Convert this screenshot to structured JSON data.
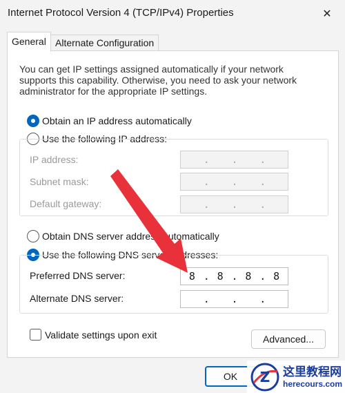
{
  "window": {
    "title": "Internet Protocol Version 4 (TCP/IPv4) Properties",
    "close_glyph": "✕"
  },
  "tabs": [
    {
      "label": "General",
      "active": true
    },
    {
      "label": "Alternate Configuration",
      "active": false
    }
  ],
  "info_text": "You can get IP settings assigned automatically if your network supports this capability. Otherwise, you need to ask your network administrator for the appropriate IP settings.",
  "ip_section": {
    "obtain_auto_label": "Obtain an IP address automatically",
    "obtain_auto_checked": true,
    "use_following_label": "Use the following IP address:",
    "use_following_checked": false,
    "fields": [
      {
        "label": "IP address:",
        "segments": [
          "",
          "",
          "",
          ""
        ]
      },
      {
        "label": "Subnet mask:",
        "segments": [
          "",
          "",
          "",
          ""
        ]
      },
      {
        "label": "Default gateway:",
        "segments": [
          "",
          "",
          "",
          ""
        ]
      }
    ]
  },
  "dns_section": {
    "obtain_auto_label": "Obtain DNS server address automatically",
    "obtain_auto_checked": false,
    "use_following_label": "Use the following DNS server addresses:",
    "use_following_checked": true,
    "preferred": {
      "label": "Preferred DNS server:",
      "segments": [
        "8",
        "8",
        "8",
        "8"
      ]
    },
    "alternate": {
      "label": "Alternate DNS server:",
      "segments": [
        "",
        "",
        "",
        ""
      ]
    }
  },
  "validate": {
    "label": "Validate settings upon exit",
    "checked": false
  },
  "buttons": {
    "advanced": "Advanced...",
    "ok": "OK"
  },
  "watermark": {
    "name": "这里教程网",
    "url": "herecours.com",
    "logo_letter": "Z"
  },
  "colors": {
    "accent": "#0067c0",
    "arrow": "#e8313a",
    "watermark": "#1b3d9c"
  }
}
